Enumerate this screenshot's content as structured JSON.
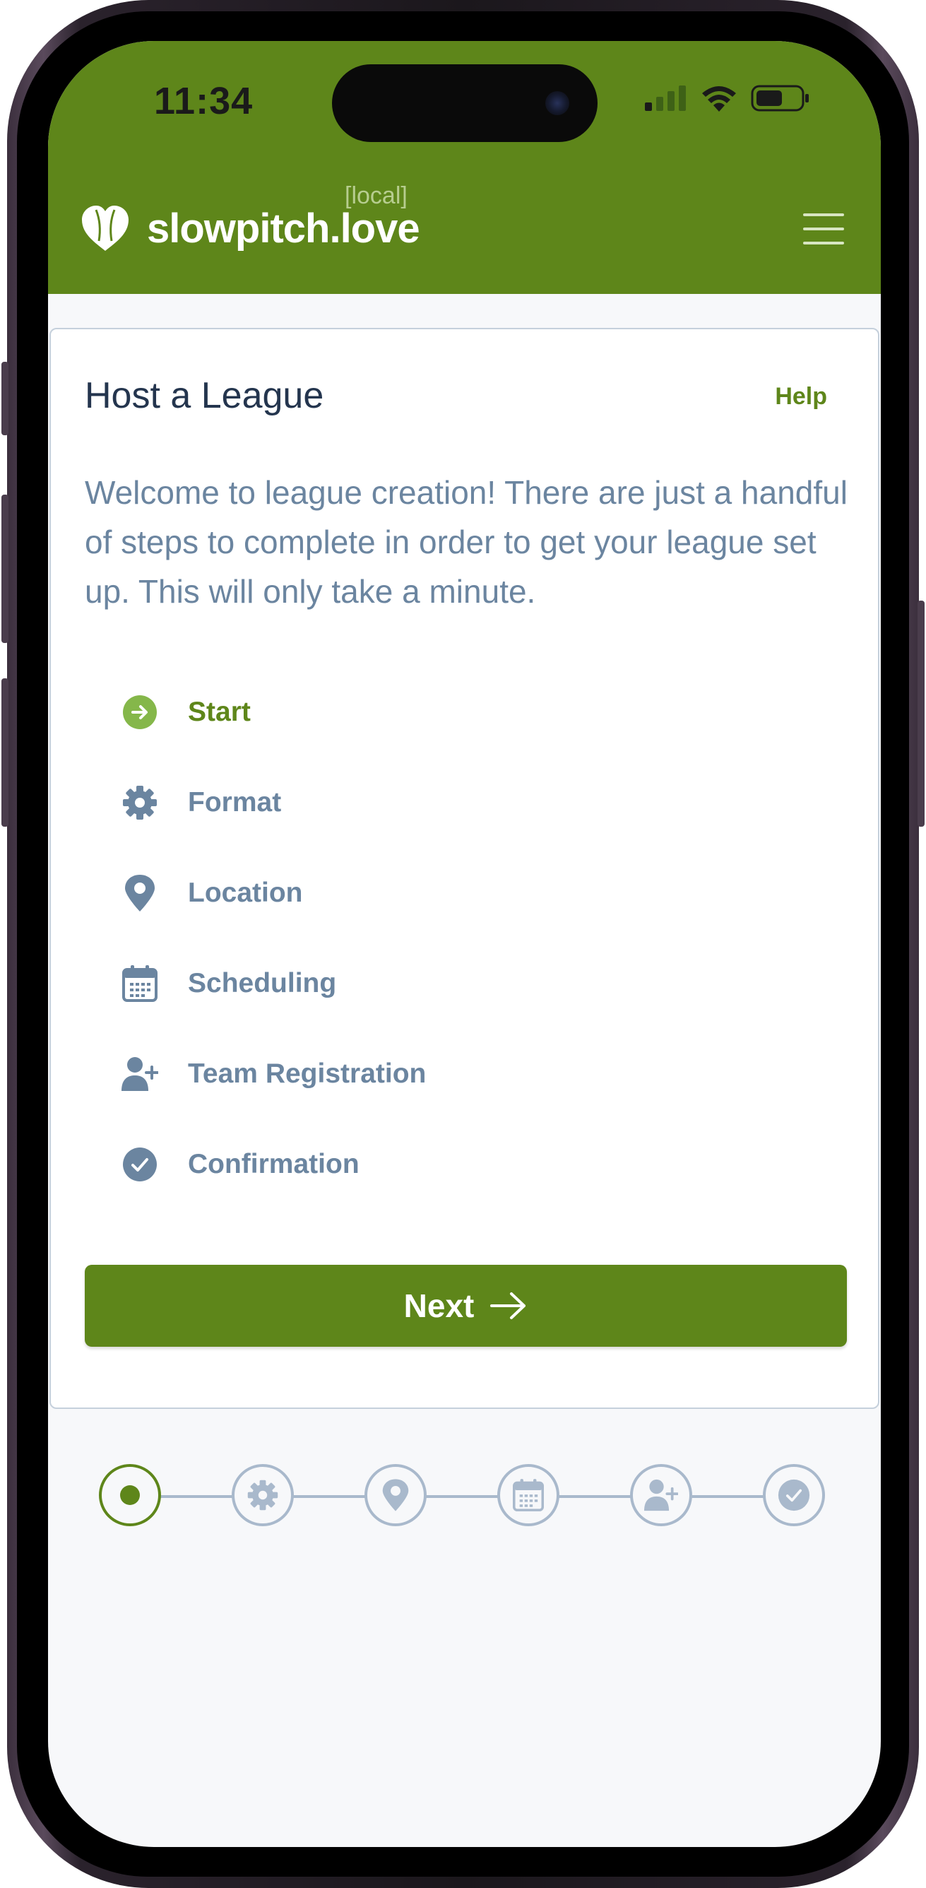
{
  "status_bar": {
    "time": "11:34",
    "icons": [
      "cellular-signal-icon",
      "wifi-icon",
      "battery-icon"
    ]
  },
  "header": {
    "brand_name": "slowpitch.love",
    "env_tag": "[local]",
    "logo_icon": "softball-heart-icon",
    "menu_icon": "hamburger-menu-icon"
  },
  "card": {
    "title": "Host a League",
    "help_label": "Help",
    "intro": "Welcome to league creation! There are just a handful of steps to complete in order to get your league set up. This will only take a minute.",
    "steps": [
      {
        "label": "Start",
        "icon": "arrow-right-circle-icon",
        "active": true
      },
      {
        "label": "Format",
        "icon": "gear-icon",
        "active": false
      },
      {
        "label": "Location",
        "icon": "map-pin-icon",
        "active": false
      },
      {
        "label": "Scheduling",
        "icon": "calendar-icon",
        "active": false
      },
      {
        "label": "Team Registration",
        "icon": "user-plus-icon",
        "active": false
      },
      {
        "label": "Confirmation",
        "icon": "check-circle-icon",
        "active": false
      }
    ],
    "next_label": "Next",
    "next_icon": "arrow-right-icon"
  },
  "progress": {
    "current_step": 1,
    "total_steps": 6
  },
  "colors": {
    "brand_green": "#5e861a",
    "active_icon_green": "#85b74a",
    "muted_slate": "#6b85a0",
    "title_navy": "#24354e",
    "stepper_gray": "#a9b9cc"
  }
}
